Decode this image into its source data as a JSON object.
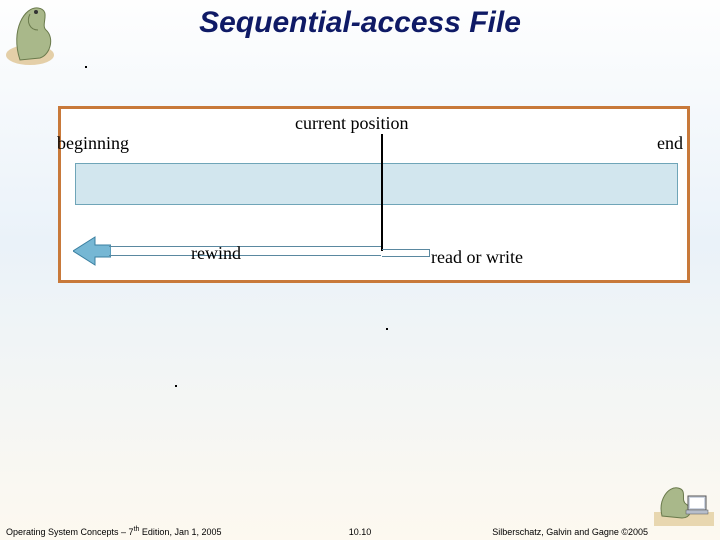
{
  "title": "Sequential-access File",
  "diagram": {
    "beginning": "beginning",
    "current_position": "current position",
    "end": "end",
    "rewind": "rewind",
    "read_or_write": "read or write"
  },
  "footer": {
    "left_pre": "Operating System Concepts – 7",
    "left_sup": "th",
    "left_post": " Edition, Jan 1, 2005",
    "center": "10.10",
    "right": "Silberschatz, Galvin and Gagne ©2005"
  },
  "icons": {
    "logo_tl": "dinosaur-logo",
    "logo_br": "dinosaur-computer-logo"
  }
}
